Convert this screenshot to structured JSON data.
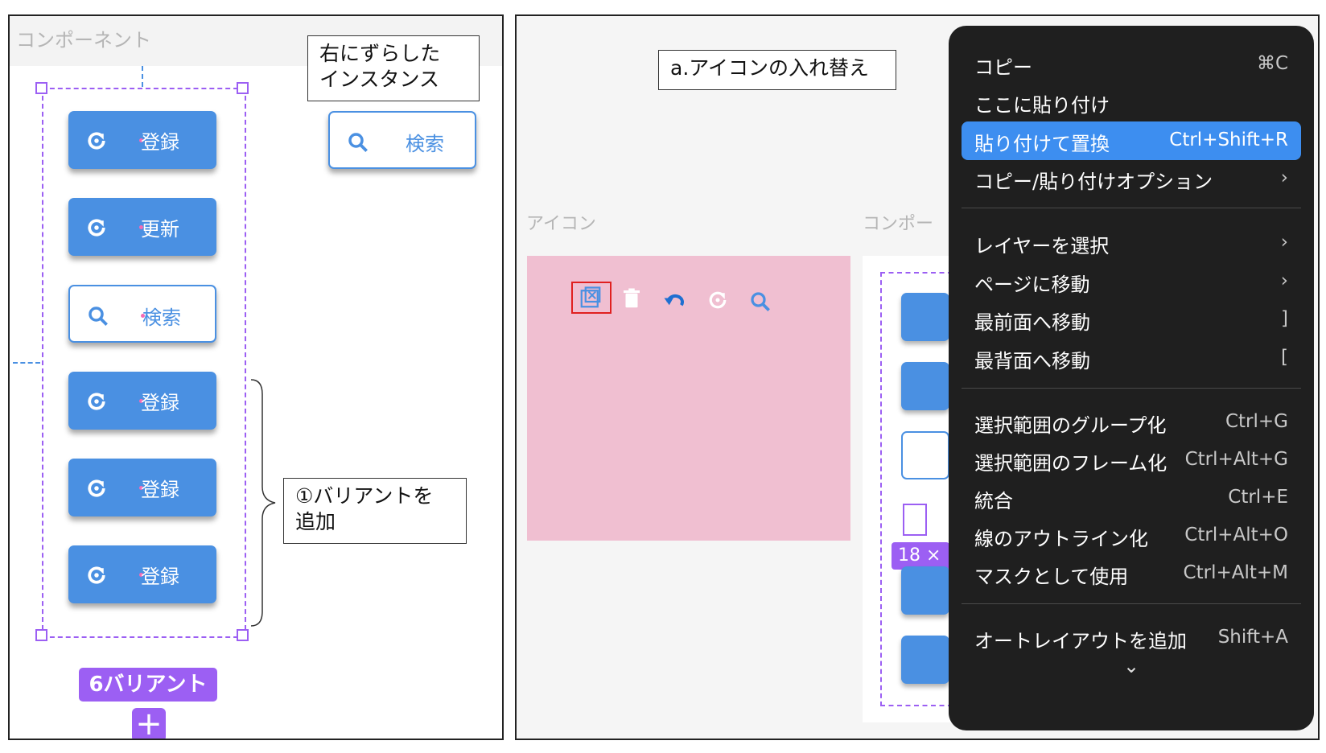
{
  "left": {
    "section_label": "コンポーネント",
    "variants": [
      {
        "label": "登録",
        "style": "filled",
        "icon": "refresh-icon"
      },
      {
        "label": "更新",
        "style": "filled",
        "icon": "refresh-icon"
      },
      {
        "label": "検索",
        "style": "outline",
        "icon": "search-icon"
      },
      {
        "label": "登録",
        "style": "filled",
        "icon": "refresh-icon"
      },
      {
        "label": "登録",
        "style": "filled",
        "icon": "refresh-icon"
      },
      {
        "label": "登録",
        "style": "filled",
        "icon": "refresh-icon"
      }
    ],
    "instance": {
      "label": "検索",
      "icon": "search-icon"
    },
    "note_instance": "右にずらした\nインスタンス",
    "note_add_variant": "①バリアントを\n追加",
    "variant_badge": "6バリアント",
    "plus_symbol": "+"
  },
  "right": {
    "note_swap": "a.アイコンの入れ替え",
    "icon_section_label": "アイコン",
    "component_section_label": "コンポー",
    "size_badge": "18 ×",
    "icons": [
      "image-placeholder-icon",
      "trash-icon",
      "undo-icon",
      "refresh-icon",
      "search-icon"
    ],
    "menu": {
      "items": [
        {
          "label": "コピー",
          "shortcut": "⌘C"
        },
        {
          "label": "ここに貼り付け",
          "shortcut": ""
        },
        {
          "label": "貼り付けて置換",
          "shortcut": "Ctrl+Shift+R",
          "active": true
        },
        {
          "label": "コピー/貼り付けオプション",
          "shortcut": "›"
        },
        {
          "label": "レイヤーを選択",
          "shortcut": "›"
        },
        {
          "label": "ページに移動",
          "shortcut": "›"
        },
        {
          "label": "最前面へ移動",
          "shortcut": "]"
        },
        {
          "label": "最背面へ移動",
          "shortcut": "["
        },
        {
          "label": "選択範囲のグループ化",
          "shortcut": "Ctrl+G"
        },
        {
          "label": "選択範囲のフレーム化",
          "shortcut": "Ctrl+Alt+G"
        },
        {
          "label": "統合",
          "shortcut": "Ctrl+E"
        },
        {
          "label": "線のアウトライン化",
          "shortcut": "Ctrl+Alt+O"
        },
        {
          "label": "マスクとして使用",
          "shortcut": "Ctrl+Alt+M"
        },
        {
          "label": "オートレイアウトを追加",
          "shortcut": "Shift+A"
        }
      ],
      "more_symbol": "⌄"
    }
  },
  "colors": {
    "button_blue": "#4a90e2",
    "selection_purple": "#9c5ff3",
    "menu_background": "#1f1f1f",
    "menu_highlight": "#3d8ef0",
    "icon_frame_pink": "#f0bfd1"
  }
}
